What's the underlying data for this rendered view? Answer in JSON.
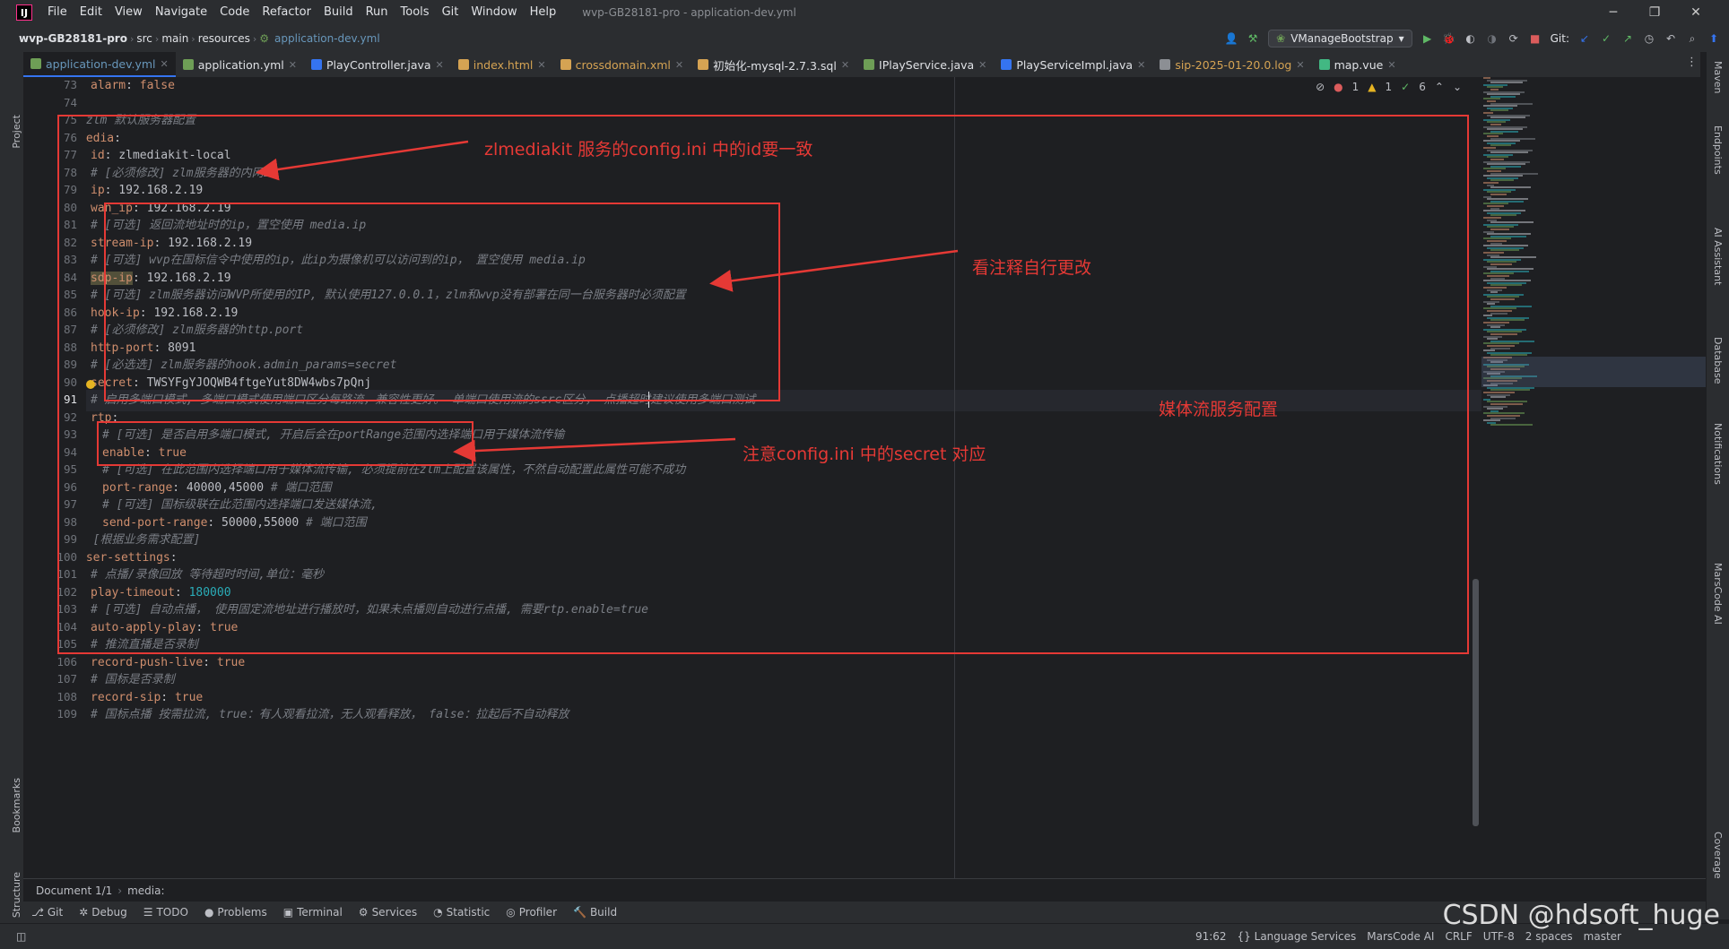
{
  "menubar": {
    "logo": "IJ",
    "items": [
      "File",
      "Edit",
      "View",
      "Navigate",
      "Code",
      "Refactor",
      "Build",
      "Run",
      "Tools",
      "Git",
      "Window",
      "Help"
    ],
    "window_title": "wvp-GB28181-pro - application-dev.yml"
  },
  "navbar": {
    "breadcrumbs": [
      "wvp-GB28181-pro",
      "src",
      "main",
      "resources"
    ],
    "current_file": "application-dev.yml",
    "run_config": "VManageBootstrap",
    "git_label": "Git:"
  },
  "tabs": [
    {
      "label": "application-dev.yml",
      "active": true,
      "icon_color": "#6e9e56"
    },
    {
      "label": "application.yml",
      "active": false,
      "icon_color": "#6e9e56"
    },
    {
      "label": "PlayController.java",
      "active": false,
      "icon_color": "#3574f0"
    },
    {
      "label": "index.html",
      "active": false,
      "icon_color": "#d5a353",
      "orange": true
    },
    {
      "label": "crossdomain.xml",
      "active": false,
      "icon_color": "#d5a353",
      "orange": true
    },
    {
      "label": "初始化-mysql-2.7.3.sql",
      "active": false,
      "icon_color": "#d5a353"
    },
    {
      "label": "IPlayService.java",
      "active": false,
      "icon_color": "#6e9e56"
    },
    {
      "label": "PlayServiceImpl.java",
      "active": false,
      "icon_color": "#3574f0"
    },
    {
      "label": "sip-2025-01-20.0.log",
      "active": false,
      "icon_color": "#8c8f94",
      "orange": true
    },
    {
      "label": "map.vue",
      "active": false,
      "icon_color": "#42b883"
    }
  ],
  "left_tools": [
    "Project",
    "Bookmarks",
    "Structure"
  ],
  "right_tools": [
    "Maven",
    "Endpoints",
    "AI Assistant",
    "Database",
    "Notifications",
    "MarsCode AI",
    "Coverage"
  ],
  "inspections": {
    "errors": "1",
    "warnings": "1",
    "ok": "6"
  },
  "lines": [
    {
      "n": "73",
      "indent": 1,
      "parts": [
        [
          "key",
          "alarm"
        ],
        [
          "val",
          ": "
        ],
        [
          "kw",
          "false"
        ]
      ]
    },
    {
      "n": "74",
      "indent": 0,
      "parts": []
    },
    {
      "n": "75",
      "indent": 0,
      "parts": [
        [
          "cmt",
          "#zlm 默认服务器配置"
        ]
      ]
    },
    {
      "n": "76",
      "indent": 0,
      "parts": [
        [
          "key",
          "media"
        ],
        [
          "val",
          ":"
        ]
      ]
    },
    {
      "n": "77",
      "indent": 1,
      "parts": [
        [
          "key",
          "id"
        ],
        [
          "val",
          ": zlmediakit-local"
        ]
      ]
    },
    {
      "n": "78",
      "indent": 1,
      "parts": [
        [
          "cmt",
          "# [必须修改] zlm服务器的内网IP"
        ]
      ]
    },
    {
      "n": "79",
      "indent": 1,
      "parts": [
        [
          "key",
          "ip"
        ],
        [
          "val",
          ": 192.168.2.19"
        ]
      ]
    },
    {
      "n": "80",
      "indent": 1,
      "parts": [
        [
          "key",
          "wan_ip"
        ],
        [
          "val",
          ": 192.168.2.19"
        ]
      ]
    },
    {
      "n": "81",
      "indent": 1,
      "parts": [
        [
          "cmt",
          "# [可选] 返回流地址时的ip，置空使用 media.ip"
        ]
      ]
    },
    {
      "n": "82",
      "indent": 1,
      "parts": [
        [
          "key",
          "stream-ip"
        ],
        [
          "val",
          ": 192.168.2.19"
        ]
      ]
    },
    {
      "n": "83",
      "indent": 1,
      "parts": [
        [
          "cmt",
          "# [可选] wvp在国标信令中使用的ip，此ip为摄像机可以访问到的ip， 置空使用 media.ip"
        ]
      ]
    },
    {
      "n": "84",
      "indent": 1,
      "parts": [
        [
          "keyhl",
          "sdp-ip"
        ],
        [
          "val",
          ": 192.168.2.19"
        ]
      ]
    },
    {
      "n": "85",
      "indent": 1,
      "parts": [
        [
          "cmt",
          "# [可选] zlm服务器访问WVP所使用的IP, 默认使用127.0.0.1，zlm和wvp没有部署在同一台服务器时必须配置"
        ]
      ]
    },
    {
      "n": "86",
      "indent": 1,
      "parts": [
        [
          "key",
          "hook-ip"
        ],
        [
          "val",
          ": 192.168.2.19"
        ]
      ]
    },
    {
      "n": "87",
      "indent": 1,
      "parts": [
        [
          "cmt",
          "# [必须修改] zlm服务器的http.port"
        ]
      ]
    },
    {
      "n": "88",
      "indent": 1,
      "parts": [
        [
          "key",
          "http-port"
        ],
        [
          "val",
          ": 8091"
        ]
      ]
    },
    {
      "n": "89",
      "indent": 1,
      "parts": [
        [
          "cmt",
          "# [必选选] zlm服务器的hook.admin_params=secret"
        ]
      ]
    },
    {
      "n": "90",
      "indent": 1,
      "parts": [
        [
          "key",
          "secret"
        ],
        [
          "val",
          ": TWSYFgYJOQWB4ftgeYut8DW4wbs7pQnj"
        ]
      ]
    },
    {
      "n": "91",
      "indent": 1,
      "parts": [
        [
          "cmt",
          "# 启用多端口模式, 多端口模式使用端口区分每路流，兼容性更好。 单端口使用流的ssrc区分， 点播超时建议使用多端口测试"
        ]
      ]
    },
    {
      "n": "92",
      "indent": 1,
      "parts": [
        [
          "key",
          "rtp"
        ],
        [
          "val",
          ":"
        ]
      ]
    },
    {
      "n": "93",
      "indent": 2,
      "parts": [
        [
          "cmt",
          "# [可选] 是否启用多端口模式, 开启后会在portRange范围内选择端口用于媒体流传输"
        ]
      ]
    },
    {
      "n": "94",
      "indent": 2,
      "parts": [
        [
          "key",
          "enable"
        ],
        [
          "val",
          ": "
        ],
        [
          "kw",
          "true"
        ]
      ]
    },
    {
      "n": "95",
      "indent": 2,
      "parts": [
        [
          "cmt",
          "# [可选] 在此范围内选择端口用于媒体流传输, 必须提前在zlm上配置该属性，不然自动配置此属性可能不成功"
        ]
      ]
    },
    {
      "n": "96",
      "indent": 2,
      "parts": [
        [
          "key",
          "port-range"
        ],
        [
          "val",
          ": 40000,45000 "
        ],
        [
          "cmt",
          "# 端口范围"
        ]
      ]
    },
    {
      "n": "97",
      "indent": 2,
      "parts": [
        [
          "cmt",
          "# [可选] 国标级联在此范围内选择端口发送媒体流,"
        ]
      ]
    },
    {
      "n": "98",
      "indent": 2,
      "parts": [
        [
          "key",
          "send-port-range"
        ],
        [
          "val",
          ": 50000,55000 "
        ],
        [
          "cmt",
          "# 端口范围"
        ]
      ]
    },
    {
      "n": "99",
      "indent": 0,
      "parts": [
        [
          "cmt",
          "# [根据业务需求配置]"
        ]
      ]
    },
    {
      "n": "100",
      "indent": 0,
      "parts": [
        [
          "key",
          "user-settings"
        ],
        [
          "val",
          ":"
        ]
      ]
    },
    {
      "n": "101",
      "indent": 1,
      "parts": [
        [
          "cmt",
          "# 点播/录像回放 等待超时时间,单位：毫秒"
        ]
      ]
    },
    {
      "n": "102",
      "indent": 1,
      "parts": [
        [
          "key",
          "play-timeout"
        ],
        [
          "val",
          ": "
        ],
        [
          "num",
          "180000"
        ]
      ]
    },
    {
      "n": "103",
      "indent": 1,
      "parts": [
        [
          "cmt",
          "# [可选] 自动点播， 使用固定流地址进行播放时，如果未点播则自动进行点播, 需要rtp.enable=true"
        ]
      ]
    },
    {
      "n": "104",
      "indent": 1,
      "parts": [
        [
          "key",
          "auto-apply-play"
        ],
        [
          "val",
          ": "
        ],
        [
          "kw",
          "true"
        ]
      ]
    },
    {
      "n": "105",
      "indent": 1,
      "parts": [
        [
          "cmt",
          "# 推流直播是否录制"
        ]
      ]
    },
    {
      "n": "106",
      "indent": 1,
      "parts": [
        [
          "key",
          "record-push-live"
        ],
        [
          "val",
          ": "
        ],
        [
          "kw",
          "true"
        ]
      ]
    },
    {
      "n": "107",
      "indent": 1,
      "parts": [
        [
          "cmt",
          "# 国标是否录制"
        ]
      ]
    },
    {
      "n": "108",
      "indent": 1,
      "parts": [
        [
          "key",
          "record-sip"
        ],
        [
          "val",
          ": "
        ],
        [
          "kw",
          "true"
        ]
      ]
    },
    {
      "n": "109",
      "indent": 1,
      "parts": [
        [
          "cmt",
          "# 国标点播 按需拉流, true：有人观看拉流，无人观看释放， false：拉起后不自动释放"
        ]
      ]
    }
  ],
  "current_line": "91",
  "annotations": {
    "id_note": "zlmediakit 服务的config.ini 中的id要一致",
    "comment_note": "看注释自行更改",
    "media_note": "媒体流服务配置",
    "secret_note": "注意config.ini 中的secret 对应"
  },
  "bottom_breadcrumb": {
    "doc": "Document 1/1",
    "path": "media:"
  },
  "tool_windows": [
    {
      "icon": "⎇",
      "label": "Git"
    },
    {
      "icon": "✲",
      "label": "Debug"
    },
    {
      "icon": "☰",
      "label": "TODO"
    },
    {
      "icon": "●",
      "label": "Problems"
    },
    {
      "icon": "▣",
      "label": "Terminal"
    },
    {
      "icon": "⚙",
      "label": "Services"
    },
    {
      "icon": "◔",
      "label": "Statistic"
    },
    {
      "icon": "◎",
      "label": "Profiler"
    },
    {
      "icon": "🔨",
      "label": "Build"
    }
  ],
  "status": {
    "position": "91:62",
    "language_services": "{} Language Services",
    "marscode": "MarsCode AI",
    "line_sep": "CRLF",
    "encoding": "UTF-8",
    "indent": "2 spaces",
    "branch": "master"
  },
  "watermark": "CSDN @hdsoft_huge",
  "colors": {
    "annotation_red": "#e53935",
    "accent": "#3574f0"
  }
}
